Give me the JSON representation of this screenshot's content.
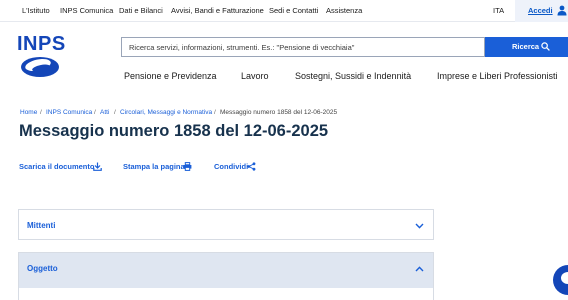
{
  "topbar": {
    "links": [
      "L'Istituto",
      "INPS Comunica",
      "Dati e Bilanci",
      "Avvisi, Bandi e Fatturazione",
      "Sedi e Contatti",
      "Assistenza"
    ],
    "language": "ITA",
    "login_label": "Accedi"
  },
  "header": {
    "logo_text": "INPS",
    "search_placeholder": "Ricerca servizi, informazioni, strumenti. Es.: \"Pensione di vecchiaia\"",
    "search_button": "Ricerca"
  },
  "mainnav": [
    "Pensione e Previdenza",
    "Lavoro",
    "Sostegni, Sussidi e Indennità",
    "Imprese e Liberi Professionisti"
  ],
  "breadcrumb": [
    "Home",
    "INPS Comunica",
    "Atti",
    "Circolari, Messaggi e Normativa",
    "Messaggio numero 1858 del 12-06-2025"
  ],
  "page_title": "Messaggio numero 1858 del 12-06-2025",
  "actions": {
    "download": "Scarica il documento",
    "print": "Stampa la pagina",
    "share": "Condividi"
  },
  "accordion": [
    {
      "label": "Mittenti",
      "expanded": false
    },
    {
      "label": "Oggetto",
      "expanded": true
    }
  ],
  "colors": {
    "brand_blue": "#1a5fd8",
    "title_navy": "#17324d",
    "logo_blue": "#1446b8"
  }
}
